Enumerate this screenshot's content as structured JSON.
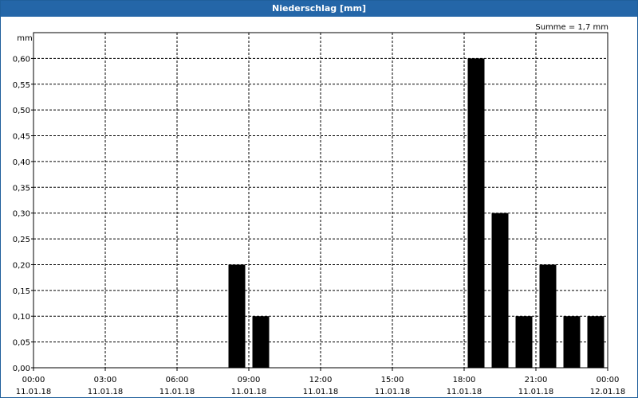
{
  "window": {
    "title": "Niederschlag [mm]"
  },
  "chart_data": {
    "type": "bar",
    "title": "Niederschlag [mm]",
    "ylabel": "mm",
    "annotation": "Summe = 1,7 mm",
    "ylim": [
      0,
      0.65
    ],
    "yticks": [
      "0,00",
      "0,05",
      "0,10",
      "0,15",
      "0,20",
      "0,25",
      "0,30",
      "0,35",
      "0,40",
      "0,45",
      "0,50",
      "0,55",
      "0,60"
    ],
    "xlim_hours": [
      0,
      24
    ],
    "xticks": [
      {
        "time": "00:00",
        "date": "11.01.18"
      },
      {
        "time": "03:00",
        "date": "11.01.18"
      },
      {
        "time": "06:00",
        "date": "11.01.18"
      },
      {
        "time": "09:00",
        "date": "11.01.18"
      },
      {
        "time": "12:00",
        "date": "11.01.18"
      },
      {
        "time": "15:00",
        "date": "11.01.18"
      },
      {
        "time": "18:00",
        "date": "11.01.18"
      },
      {
        "time": "21:00",
        "date": "11.01.18"
      },
      {
        "time": "00:00",
        "date": "12.01.18"
      }
    ],
    "bars": [
      {
        "hour": 8.5,
        "value": 0.2
      },
      {
        "hour": 9.5,
        "value": 0.1
      },
      {
        "hour": 18.5,
        "value": 0.6
      },
      {
        "hour": 19.5,
        "value": 0.3
      },
      {
        "hour": 20.5,
        "value": 0.1
      },
      {
        "hour": 21.5,
        "value": 0.2
      },
      {
        "hour": 22.5,
        "value": 0.1
      },
      {
        "hour": 23.5,
        "value": 0.1
      }
    ],
    "grid": true,
    "colors": {
      "bar": "#000000",
      "grid": "#000000",
      "titlebar": "#2466a8"
    }
  }
}
